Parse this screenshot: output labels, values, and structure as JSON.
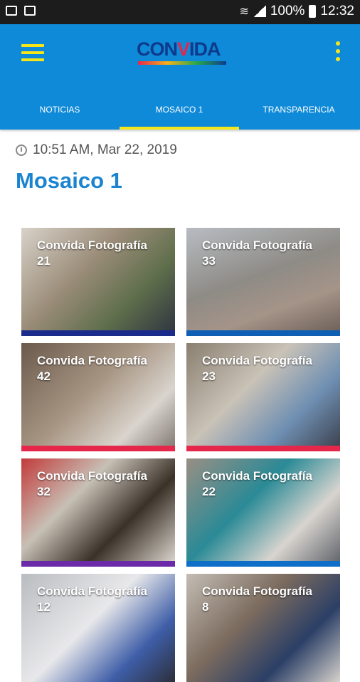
{
  "status_bar": {
    "battery": "100%",
    "time": "12:32"
  },
  "app_bar": {
    "logo_text": "CONVIDA",
    "menu_icon": "menu-icon",
    "overflow_icon": "more-vert-icon"
  },
  "tabs": [
    {
      "label": "NOTICIAS"
    },
    {
      "label": "MOSAICO 1",
      "active": true
    },
    {
      "label": "TRANSPARENCIA"
    }
  ],
  "post": {
    "timestamp": "10:51 AM, Mar 22, 2019",
    "title": "Mosaico 1"
  },
  "tiles": [
    {
      "title": "Convida Fotografía",
      "number": "21",
      "strip_color": "#1b2b8c"
    },
    {
      "title": "Convida Fotografía",
      "number": "33",
      "strip_color": "#0f5fb5"
    },
    {
      "title": "Convida Fotografía",
      "number": "42",
      "strip_color": "#e5274b"
    },
    {
      "title": "Convida Fotografía",
      "number": "23",
      "strip_color": "#e5274b"
    },
    {
      "title": "Convida Fotografía",
      "number": "32",
      "strip_color": "#6b2aa8"
    },
    {
      "title": "Convida Fotografía",
      "number": "22",
      "strip_color": "#0f6ec7"
    },
    {
      "title": "Convida Fotografía",
      "number": "12",
      "strip_color": "#0f6ec7"
    },
    {
      "title": "Convida Fotografía",
      "number": "8",
      "strip_color": "#0f6ec7"
    }
  ],
  "colors": {
    "app_bar": "#0f8ad8",
    "accent": "#f5e61a",
    "title": "#1a84d0"
  }
}
